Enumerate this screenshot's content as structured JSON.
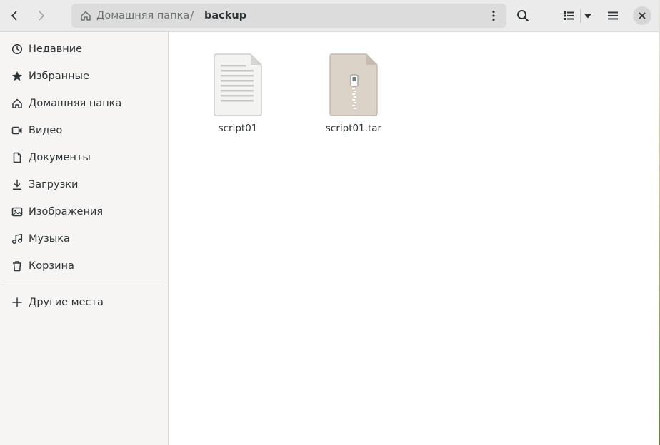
{
  "header": {
    "back_icon": "chevron-left-icon",
    "forward_icon": "chevron-right-icon",
    "path": {
      "home_label": "Домашняя папка",
      "separator": "/",
      "current": "backup"
    },
    "search_icon": "search-icon",
    "view_icon": "list-view-icon",
    "view_options_icon": "triangle-down-icon",
    "menu_icon": "hamburger-menu-icon",
    "close_icon": "close-icon"
  },
  "sidebar": {
    "items": [
      {
        "label": "Недавние",
        "icon": "clock-icon"
      },
      {
        "label": "Избранные",
        "icon": "star-icon"
      },
      {
        "label": "Домашняя папка",
        "icon": "home-icon"
      },
      {
        "label": "Видео",
        "icon": "video-icon"
      },
      {
        "label": "Документы",
        "icon": "document-icon"
      },
      {
        "label": "Загрузки",
        "icon": "download-icon"
      },
      {
        "label": "Изображения",
        "icon": "image-icon"
      },
      {
        "label": "Музыка",
        "icon": "music-icon"
      },
      {
        "label": "Корзина",
        "icon": "trash-icon"
      }
    ],
    "other_places": {
      "label": "Другие места",
      "icon": "plus-icon"
    }
  },
  "files": [
    {
      "name": "script01",
      "icon": "text-file-icon"
    },
    {
      "name": "script01.tar",
      "icon": "archive-file-icon"
    }
  ],
  "colors": {
    "headerbar": "#ebebeb",
    "sidebar": "#f6f5f4",
    "content": "#ffffff",
    "text": "#2e3436",
    "archive": "#dcd3c8"
  }
}
